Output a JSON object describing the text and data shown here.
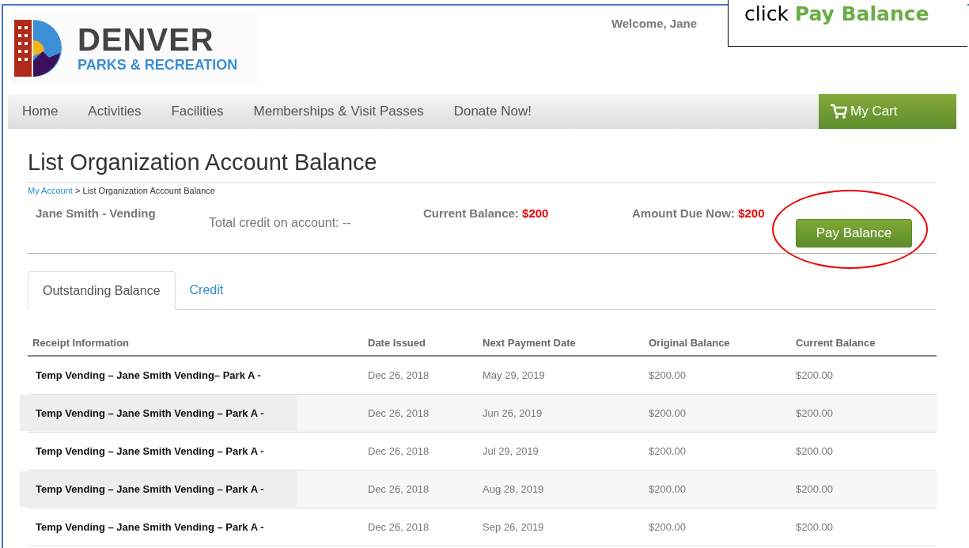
{
  "logo": {
    "title": "DENVER",
    "subtitle": "PARKS & RECREATION"
  },
  "welcome": "Welcome, Jane",
  "callout": {
    "text": "click",
    "highlight": "Pay Balance"
  },
  "nav": {
    "items": [
      "Home",
      "Activities",
      "Facilities",
      "Memberships & Visit Passes",
      "Donate Now!"
    ],
    "cart": "My Cart"
  },
  "page_title": "List Organization Account Balance",
  "breadcrumb": {
    "link": "My Account",
    "current": "> List Organization Account Balance"
  },
  "account": {
    "name": "Jane Smith - Vending",
    "credit": "Total credit on account: --",
    "current_label": "Current Balance:",
    "current_value": "$200",
    "due_label": "Amount Due Now:",
    "due_value": "$200",
    "pay_button": "Pay Balance",
    "pay_highlighted": true
  },
  "tabs": [
    {
      "label": "Outstanding Balance",
      "selected": true
    },
    {
      "label": "Credit",
      "selected": false
    }
  ],
  "table": {
    "columns": [
      "Receipt Information",
      "Date Issued",
      "Next Payment Date",
      "Original Balance",
      "Current Balance"
    ],
    "rows": [
      [
        "Temp Vending – Jane Smith Vending– Park A -",
        "Dec 26, 2018",
        "May 29, 2019",
        "$200.00",
        "$200.00"
      ],
      [
        "Temp Vending – Jane Smith Vending – Park A -",
        "Dec 26, 2018",
        "Jun 26, 2019",
        "$200.00",
        "$200.00"
      ],
      [
        "Temp Vending – Jane Smith Vending – Park A -",
        "Dec 26, 2018",
        "Jul 29, 2019",
        "$200.00",
        "$200.00"
      ],
      [
        "Temp Vending – Jane Smith Vending – Park A -",
        "Dec 26, 2018",
        "Aug 28, 2019",
        "$200.00",
        "$200.00"
      ],
      [
        "Temp Vending – Jane Smith Vending – Park A -",
        "Dec 26, 2018",
        "Sep 26, 2019",
        "$200.00",
        "$200.00"
      ]
    ]
  }
}
